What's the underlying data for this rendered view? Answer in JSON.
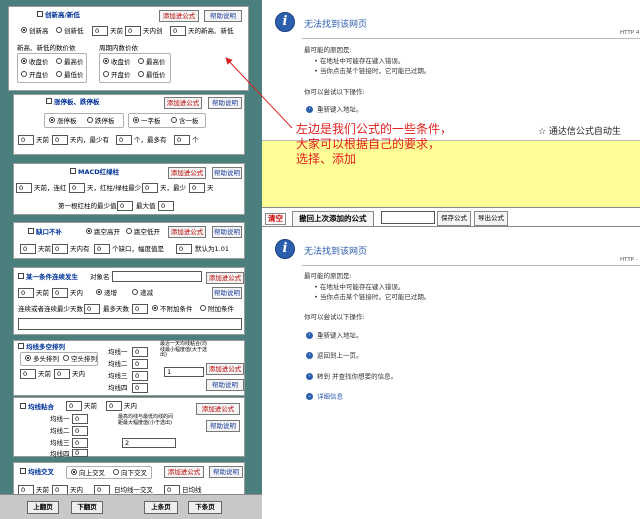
{
  "colors": {
    "background": "#4a7f7d",
    "annotation": "#e02020",
    "yellow_area": "#fdfd96",
    "link_blue": "#2a5caa"
  },
  "common": {
    "add_formula": "添加进公式",
    "help": "帮助说明"
  },
  "panels": {
    "p1": {
      "title": "创新高/新低",
      "r_high": "创新高",
      "r_low": "创新低",
      "v0": "0",
      "t1": "天前",
      "v1": "0",
      "t2": "天内创",
      "v2": "0",
      "t3": "天的新高、新低",
      "grp_a": "新高、新低的数价依",
      "grp_b": "周期内数价依",
      "close": "收盘价",
      "highest": "最高价",
      "open": "开盘价",
      "lowest": "最低价"
    },
    "p2": {
      "title": "涨停板、跌停板",
      "r_up": "涨停板",
      "r_down": "跌停板",
      "r_one": "一字板",
      "r_incl": "含一板",
      "v0": "0",
      "t1": "天前",
      "v1": "0",
      "t2": "天内，最少有",
      "v2": "0",
      "t3": "个，最多有",
      "v3": "0",
      "t4": "个"
    },
    "p3": {
      "title": "MACD红绿柱",
      "v0": "0",
      "t1": "天前，连红",
      "v1": "0",
      "t2": "天，红柱/绿柱最少",
      "v2": "0",
      "t3": "天，最少",
      "v3": "0",
      "t4": "天",
      "t5": "第一根红柱的最少值",
      "v4": "0",
      "t6": "最大值",
      "v5": "0"
    },
    "p4": {
      "title": "缺口不补",
      "r_up": "跳空高开",
      "r_down": "跳空低开",
      "v0": "0",
      "t1": "天前",
      "v1": "0",
      "t2": "天内有",
      "v2": "0",
      "t3": "个缺口，幅度值是",
      "v3": "0",
      "t4": "默认为1.01"
    },
    "p5": {
      "title": "某一条件连续发生",
      "t0": "对象名",
      "v0": "0",
      "t1": "天前",
      "v1": "0",
      "t2": "天内",
      "r_rise": "递增",
      "r_fall": "递减",
      "t3": "连续或者连续最少天数",
      "v2": "0",
      "t4": "最多天数",
      "v3": "0",
      "r_noattach": "不附加条件",
      "r_attach": "附加条件"
    },
    "p6": {
      "title": "均线多空排列",
      "r_long": "多头排列",
      "r_short": "空头排列",
      "v0": "0",
      "t1": "天前",
      "v1": "0",
      "t2": "天内",
      "ma1": "均线一",
      "ma2": "均线二",
      "ma3": "均线三",
      "ma4": "均线四",
      "m1": "0",
      "m2": "0",
      "m3": "0",
      "m4": "0",
      "note": "最近一天均线粘合(均线最小幅度值(大于选出)",
      "note_v": "1"
    },
    "p7": {
      "title": "均线粘合",
      "v0": "0",
      "t1": "天前",
      "v1": "0",
      "t2": "天内",
      "ma1": "均线一",
      "ma2": "均线二",
      "ma3": "均线三",
      "ma4": "均线四",
      "m1": "0",
      "m2": "0",
      "m3": "0",
      "m4": "0",
      "note": "最高均线与最低均线的间距最大幅度值(小于选出)",
      "note_v": "2"
    },
    "p8": {
      "title": "均线交叉",
      "r_up": "向上交叉",
      "r_down": "向下交叉",
      "v0": "0",
      "t1": "天前",
      "v1": "0",
      "t2": "天内",
      "v2": "0",
      "t3": "日均线一交叉",
      "v3": "0",
      "t4": "日均线"
    }
  },
  "bottom": {
    "prev_page": "上翻页",
    "next_page": "下翻页",
    "prev_item": "上条页",
    "next_item": "下条页"
  },
  "browser_error": {
    "title": "无法找到该网页",
    "http_top": "HTTP 4",
    "http_bottom": "HTTP -",
    "reasons_label": "最可能的原因是:",
    "reason1": "在地址中可能存在键入错误。",
    "reason2": "当你点击某个链接时，它可能已过期。",
    "try_label": "你可以尝试以下操作:",
    "act1": "重新键入地址。",
    "act2": "返回到上一页。",
    "act3": "转到  并查找你想要的信息。",
    "details": "详细信息"
  },
  "marquee": "☆ 通达信公式自动生",
  "annotation": {
    "line1": "左边是我们公式的一些条件，",
    "line2": "大家可以根据自己的要求，",
    "line3": "选择、添加"
  },
  "toolbar": {
    "clear": "清空",
    "recall": "撤回上次添加的公式",
    "input": "",
    "save": "保存公式",
    "export": "导出公式"
  }
}
